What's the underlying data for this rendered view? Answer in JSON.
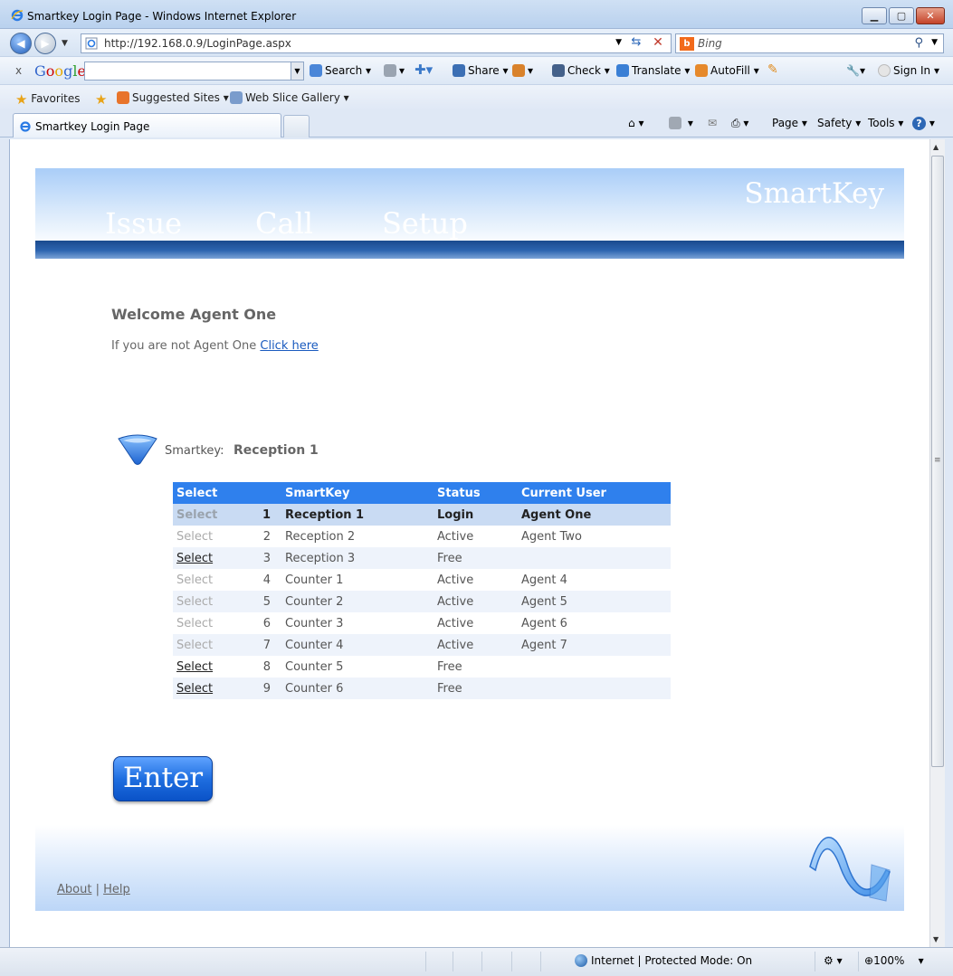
{
  "window": {
    "title": "Smartkey Login Page - Windows Internet Explorer"
  },
  "address_bar": {
    "url": "http://192.168.0.9/LoginPage.aspx",
    "search_placeholder": "Bing"
  },
  "google_toolbar": {
    "search_label": "Search",
    "share_label": "Share",
    "check_label": "Check",
    "translate_label": "Translate",
    "autofill_label": "AutoFill",
    "signin_label": "Sign In"
  },
  "favorites_bar": {
    "favorites_label": "Favorites",
    "suggested_sites": "Suggested Sites",
    "web_slice_gallery": "Web Slice Gallery"
  },
  "tab": {
    "label": "Smartkey Login Page"
  },
  "command_bar": {
    "page": "Page",
    "safety": "Safety",
    "tools": "Tools"
  },
  "banner": {
    "brand": "SmartKey",
    "nav": [
      "Issue",
      "Call",
      "Setup"
    ]
  },
  "welcome": {
    "heading": "Welcome Agent One",
    "prompt": "If you are not Agent One",
    "link": "Click here"
  },
  "smartkey": {
    "label": "Smartkey:",
    "value": "Reception 1"
  },
  "table": {
    "headers": [
      "Select",
      "",
      "SmartKey",
      "Status",
      "Current User"
    ],
    "rows": [
      {
        "select": "Select",
        "num": "1",
        "smartkey": "Reception 1",
        "status": "Login",
        "user": "Agent One"
      },
      {
        "select": "Select",
        "num": "2",
        "smartkey": "Reception 2",
        "status": "Active",
        "user": "Agent Two"
      },
      {
        "select": "Select",
        "num": "3",
        "smartkey": "Reception 3",
        "status": "Free",
        "user": ""
      },
      {
        "select": "Select",
        "num": "4",
        "smartkey": "Counter 1",
        "status": "Active",
        "user": "Agent 4"
      },
      {
        "select": "Select",
        "num": "5",
        "smartkey": "Counter 2",
        "status": "Active",
        "user": "Agent 5"
      },
      {
        "select": "Select",
        "num": "6",
        "smartkey": "Counter 3",
        "status": "Active",
        "user": "Agent 6"
      },
      {
        "select": "Select",
        "num": "7",
        "smartkey": "Counter 4",
        "status": "Active",
        "user": "Agent 7"
      },
      {
        "select": "Select",
        "num": "8",
        "smartkey": "Counter 5",
        "status": "Free",
        "user": ""
      },
      {
        "select": "Select",
        "num": "9",
        "smartkey": "Counter 6",
        "status": "Free",
        "user": ""
      }
    ]
  },
  "enter_button": {
    "label": "Enter"
  },
  "footer": {
    "about": "About",
    "separator": "|",
    "help": "Help"
  },
  "status_bar": {
    "zone": "Internet | Protected Mode: On",
    "zoom": "100%"
  },
  "colors": {
    "accent": "#2f80ed",
    "banner_bar": "#1a4a8e",
    "enter_button": "#1f6ee0"
  }
}
